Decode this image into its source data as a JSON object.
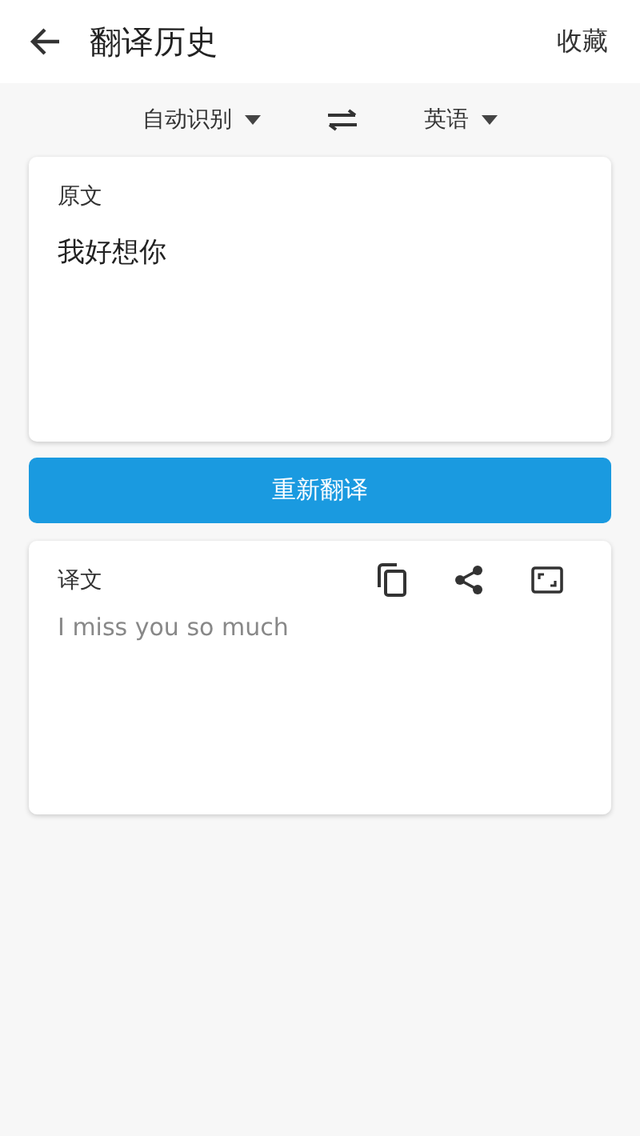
{
  "header": {
    "title": "翻译历史",
    "action": "收藏"
  },
  "languages": {
    "source": "自动识别",
    "target": "英语"
  },
  "source": {
    "label": "原文",
    "text": "我好想你"
  },
  "retranslate_button": "重新翻译",
  "result": {
    "label": "译文",
    "text": "I miss you so much"
  }
}
